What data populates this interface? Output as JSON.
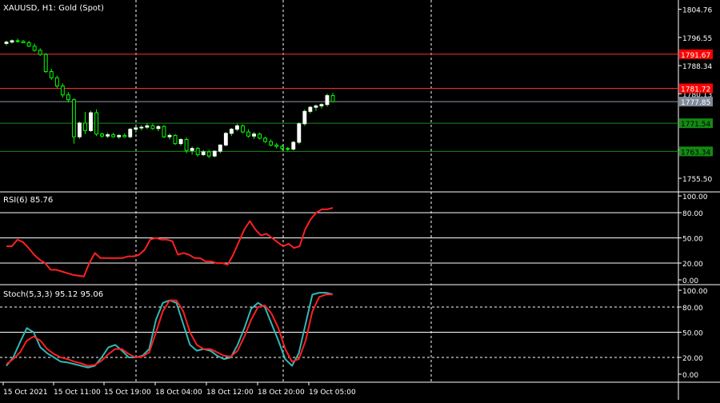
{
  "main": {
    "title": "XAUUSD, H1:  Gold (Spot)",
    "price_ticks": [
      "1804.76",
      "1796.55",
      "1788.34",
      "1780.13",
      "1763.71",
      "1755.50"
    ],
    "hlines": [
      {
        "value": 1791.67,
        "label": "1791.67",
        "color": "#ff2a2a",
        "label_bg": "#ff0000"
      },
      {
        "value": 1781.72,
        "label": "1781.72",
        "color": "#ff2a2a",
        "label_bg": "#ff0000"
      },
      {
        "value": 1777.85,
        "label": "1777.85",
        "color": "#8f9aa8",
        "label_bg": "#7f8a99"
      },
      {
        "value": 1771.54,
        "label": "1771.54",
        "color": "#1a8a1a",
        "label_bg": "#138a13"
      },
      {
        "value": 1763.34,
        "label": "1763.34",
        "color": "#1a8a1a",
        "label_bg": "#138a13"
      }
    ]
  },
  "rsi": {
    "title": "RSI(6) 85.76",
    "ticks": [
      "100.00",
      "80.00",
      "50.00",
      "20.00",
      "0.00"
    ]
  },
  "stoch": {
    "title": "Stoch(5,3,3) 95.12 95.06",
    "ticks": [
      "100.00",
      "80.00",
      "50.00",
      "20.00",
      "0.00"
    ]
  },
  "x_ticks": [
    "15 Oct 2021",
    "15 Oct 11:00",
    "15 Oct 19:00",
    "18 Oct 04:00",
    "18 Oct 12:00",
    "18 Oct 20:00",
    "19 Oct 05:00"
  ],
  "colors": {
    "background": "#000000",
    "bull_candle": "#ffffff",
    "bear_candle": "#00ff00",
    "rsi_line": "#ff2020",
    "stoch_main": "#33b7b7",
    "stoch_signal": "#ff2020",
    "grid": "#ffffff",
    "text": "#ffffff"
  },
  "chart_data": [
    {
      "type": "candlestick",
      "title": "XAUUSD, H1:  Gold (Spot)",
      "ylim": [
        1752,
        1807
      ],
      "series": [
        {
          "values": [
            [
              1794.8,
              1795.6,
              1794.2,
              1795.2
            ],
            [
              1795.2,
              1796.0,
              1794.8,
              1795.6
            ],
            [
              1795.6,
              1796.2,
              1795.0,
              1795.4
            ],
            [
              1795.4,
              1795.8,
              1794.9,
              1795.0
            ],
            [
              1795.0,
              1795.6,
              1793.8,
              1794.0
            ],
            [
              1794.0,
              1794.8,
              1792.4,
              1792.8
            ],
            [
              1792.8,
              1793.4,
              1791.2,
              1791.6
            ],
            [
              1791.6,
              1792.0,
              1786.2,
              1786.6
            ],
            [
              1786.6,
              1787.4,
              1784.2,
              1784.8
            ],
            [
              1784.8,
              1785.4,
              1781.8,
              1782.4
            ],
            [
              1782.4,
              1783.2,
              1779.0,
              1779.8
            ],
            [
              1779.8,
              1780.6,
              1777.6,
              1778.4
            ],
            [
              1778.4,
              1778.8,
              1765.6,
              1767.6
            ],
            [
              1767.6,
              1772.0,
              1767.0,
              1771.6
            ],
            [
              1771.6,
              1774.8,
              1768.4,
              1769.4
            ],
            [
              1769.4,
              1775.2,
              1769.0,
              1774.6
            ],
            [
              1774.6,
              1775.6,
              1767.8,
              1768.4
            ],
            [
              1768.4,
              1768.8,
              1767.4,
              1767.8
            ],
            [
              1767.8,
              1768.8,
              1767.2,
              1768.2
            ],
            [
              1768.2,
              1768.8,
              1767.4,
              1767.6
            ],
            [
              1767.6,
              1768.4,
              1767.0,
              1768.0
            ],
            [
              1768.0,
              1768.6,
              1767.4,
              1767.6
            ],
            [
              1767.6,
              1770.2,
              1767.2,
              1769.8
            ],
            [
              1769.8,
              1770.6,
              1768.8,
              1770.2
            ],
            [
              1770.2,
              1771.0,
              1769.4,
              1770.4
            ],
            [
              1770.4,
              1771.6,
              1769.8,
              1770.8
            ],
            [
              1770.8,
              1771.4,
              1769.6,
              1770.0
            ],
            [
              1770.0,
              1771.0,
              1769.2,
              1770.6
            ],
            [
              1770.6,
              1771.0,
              1767.2,
              1767.6
            ],
            [
              1767.6,
              1768.6,
              1766.8,
              1768.0
            ],
            [
              1768.0,
              1768.4,
              1765.2,
              1765.6
            ],
            [
              1765.6,
              1767.2,
              1765.0,
              1766.8
            ],
            [
              1766.8,
              1767.4,
              1762.8,
              1763.6
            ],
            [
              1763.6,
              1764.8,
              1762.4,
              1764.2
            ],
            [
              1764.2,
              1764.6,
              1761.8,
              1762.4
            ],
            [
              1762.4,
              1763.8,
              1762.0,
              1763.2
            ],
            [
              1763.2,
              1763.8,
              1761.4,
              1762.0
            ],
            [
              1762.0,
              1763.6,
              1761.6,
              1763.4
            ],
            [
              1763.4,
              1765.4,
              1762.8,
              1765.2
            ],
            [
              1765.2,
              1769.0,
              1764.8,
              1768.6
            ],
            [
              1768.6,
              1770.2,
              1767.8,
              1769.8
            ],
            [
              1769.8,
              1771.4,
              1769.2,
              1770.8
            ],
            [
              1770.8,
              1771.2,
              1768.6,
              1769.0
            ],
            [
              1769.0,
              1769.8,
              1767.4,
              1767.8
            ],
            [
              1767.8,
              1769.0,
              1767.0,
              1768.4
            ],
            [
              1768.4,
              1768.8,
              1766.8,
              1767.2
            ],
            [
              1767.2,
              1767.6,
              1765.8,
              1766.2
            ],
            [
              1766.2,
              1766.8,
              1764.8,
              1765.2
            ],
            [
              1765.2,
              1765.8,
              1764.2,
              1764.8
            ],
            [
              1764.8,
              1765.2,
              1763.6,
              1764.2
            ],
            [
              1764.2,
              1764.6,
              1763.4,
              1764.0
            ],
            [
              1764.0,
              1766.4,
              1763.6,
              1766.0
            ],
            [
              1766.0,
              1771.8,
              1765.4,
              1771.4
            ],
            [
              1771.4,
              1775.6,
              1770.8,
              1775.0
            ],
            [
              1775.0,
              1776.6,
              1774.4,
              1776.2
            ],
            [
              1776.2,
              1777.0,
              1775.2,
              1776.6
            ],
            [
              1776.6,
              1777.4,
              1775.8,
              1777.0
            ],
            [
              1777.0,
              1780.2,
              1776.4,
              1779.6
            ],
            [
              1779.6,
              1780.4,
              1777.6,
              1777.85
            ]
          ]
        }
      ]
    },
    {
      "type": "line",
      "title": "RSI(6) 85.76",
      "ylim": [
        0,
        100
      ],
      "series": [
        {
          "values": [
            40,
            40,
            48,
            45,
            38,
            30,
            24,
            20,
            12,
            12,
            10,
            8,
            6,
            5,
            4,
            20,
            32,
            26,
            26,
            26,
            26,
            26,
            28,
            28,
            30,
            36,
            48,
            50,
            48,
            48,
            46,
            30,
            32,
            30,
            26,
            26,
            22,
            22,
            20,
            20,
            18,
            30,
            45,
            60,
            70,
            60,
            53,
            55,
            50,
            45,
            40,
            43,
            38,
            40,
            60,
            72,
            80,
            84,
            84,
            85.76
          ]
        }
      ]
    },
    {
      "type": "line",
      "title": "Stoch(5,3,3) 95.12 95.06",
      "ylim": [
        0,
        100
      ],
      "series": [
        {
          "values": [
            10,
            20,
            38,
            55,
            50,
            32,
            25,
            20,
            15,
            14,
            12,
            10,
            8,
            10,
            20,
            32,
            35,
            28,
            20,
            20,
            22,
            30,
            65,
            85,
            88,
            85,
            60,
            35,
            28,
            30,
            28,
            22,
            18,
            20,
            35,
            55,
            78,
            85,
            80,
            60,
            40,
            18,
            10,
            25,
            60,
            95,
            97,
            97,
            95.12
          ]
        },
        {
          "values": [
            12,
            18,
            26,
            40,
            45,
            40,
            30,
            24,
            20,
            18,
            15,
            13,
            10,
            11,
            16,
            24,
            30,
            30,
            24,
            20,
            21,
            26,
            50,
            75,
            88,
            88,
            75,
            50,
            35,
            30,
            30,
            26,
            22,
            21,
            28,
            45,
            65,
            80,
            82,
            72,
            55,
            30,
            15,
            18,
            40,
            75,
            92,
            95,
            95.06
          ]
        }
      ]
    }
  ]
}
